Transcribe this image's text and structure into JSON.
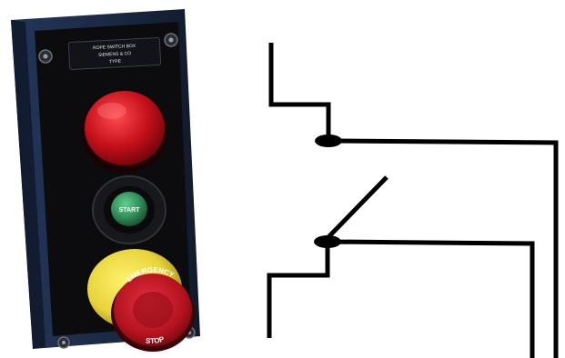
{
  "image": {
    "subject": "push-button control station and contact schematic"
  },
  "control_station": {
    "nameplate_lines": [
      "ROPE SWITCH BOX",
      "SIEMENS & CO",
      "TYPE"
    ],
    "start_button_label": "START",
    "emergency_button_label_top": "EMERGENCY",
    "emergency_button_label_bottom": "STOP",
    "colors": {
      "housing": "#1b2a44",
      "faceplate": "#0c0c0f",
      "stop_button": "#c8111b",
      "start_button": "#2f8a56",
      "emergency_collar": "#e8d33a",
      "emergency_cap": "#b1121e"
    }
  },
  "schematic": {
    "contacts": [
      {
        "kind": "normally-closed"
      },
      {
        "kind": "normally-open"
      }
    ],
    "line_color": "#000000"
  }
}
